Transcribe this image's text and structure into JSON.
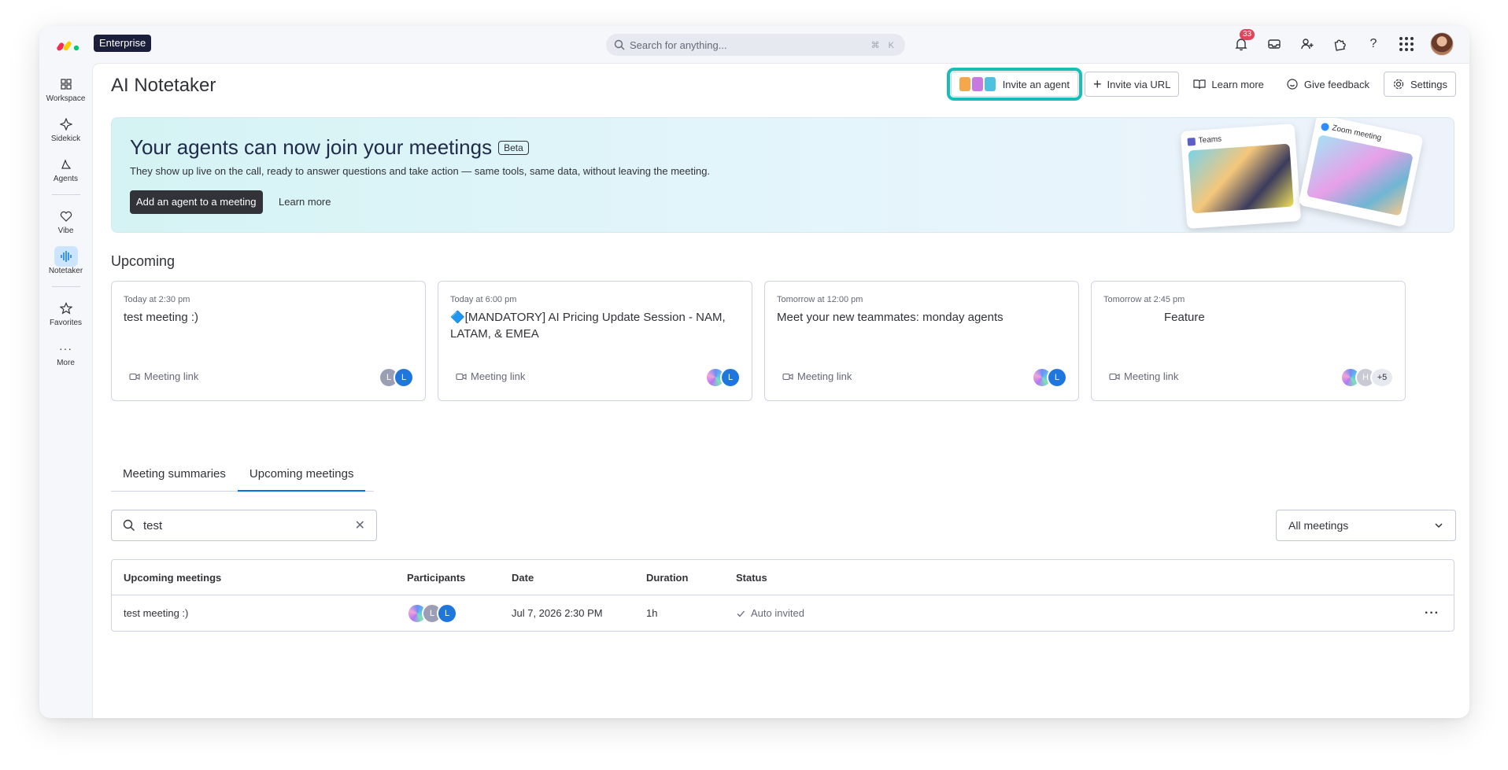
{
  "app": {
    "plan_badge": "Enterprise",
    "search_placeholder": "Search for anything...",
    "search_shortcut": "⌘ K",
    "notifications_count": "33"
  },
  "sidebar": {
    "items": [
      {
        "label": "Workspace"
      },
      {
        "label": "Sidekick"
      },
      {
        "label": "Agents"
      },
      {
        "label": "Vibe"
      },
      {
        "label": "Notetaker"
      },
      {
        "label": "Favorites"
      },
      {
        "label": "More"
      }
    ]
  },
  "header": {
    "title": "AI Notetaker",
    "invite_agent": "Invite an agent",
    "invite_url": "Invite via URL",
    "learn_more": "Learn more",
    "give_feedback": "Give feedback",
    "settings": "Settings"
  },
  "banner": {
    "title": "Your agents can now join your meetings",
    "beta": "Beta",
    "subtitle": "They show up live on the call, ready to answer questions and take action — same tools, same data, without leaving the meeting.",
    "cta": "Add an agent to a meeting",
    "learn_more": "Learn more",
    "card_teams": "Teams",
    "card_zoom": "Zoom meeting"
  },
  "upcoming": {
    "title": "Upcoming",
    "cards": [
      {
        "time": "Today at 2:30 pm",
        "title": "test meeting :)",
        "link": "Meeting link",
        "p1": "L",
        "p2": "L"
      },
      {
        "time": "Today at 6:00 pm",
        "title": "🔷[MANDATORY] AI Pricing Update Session - NAM, LATAM, & EMEA",
        "link": "Meeting link",
        "p2": "L"
      },
      {
        "time": "Tomorrow at 12:00 pm",
        "title": "Meet your new teammates: monday agents",
        "link": "Meeting link",
        "p2": "L"
      },
      {
        "time": "Tomorrow at 2:45 pm",
        "title": "Feature",
        "link": "Meeting link",
        "p2": "H",
        "more": "+5"
      }
    ]
  },
  "tabs": {
    "summaries": "Meeting summaries",
    "upcoming": "Upcoming meetings"
  },
  "filter": {
    "search_value": "test",
    "select_value": "All meetings"
  },
  "table": {
    "headers": {
      "meeting": "Upcoming meetings",
      "participants": "Participants",
      "date": "Date",
      "duration": "Duration",
      "status": "Status"
    },
    "rows": [
      {
        "meeting": "test meeting :)",
        "p1": "L",
        "p2": "L",
        "date": "Jul 7, 2026 2:30 PM",
        "duration": "1h",
        "status": "Auto invited"
      }
    ]
  },
  "colors": {
    "accent": "#0073ea",
    "highlight": "#19bdb8",
    "notification": "#e2445c"
  }
}
